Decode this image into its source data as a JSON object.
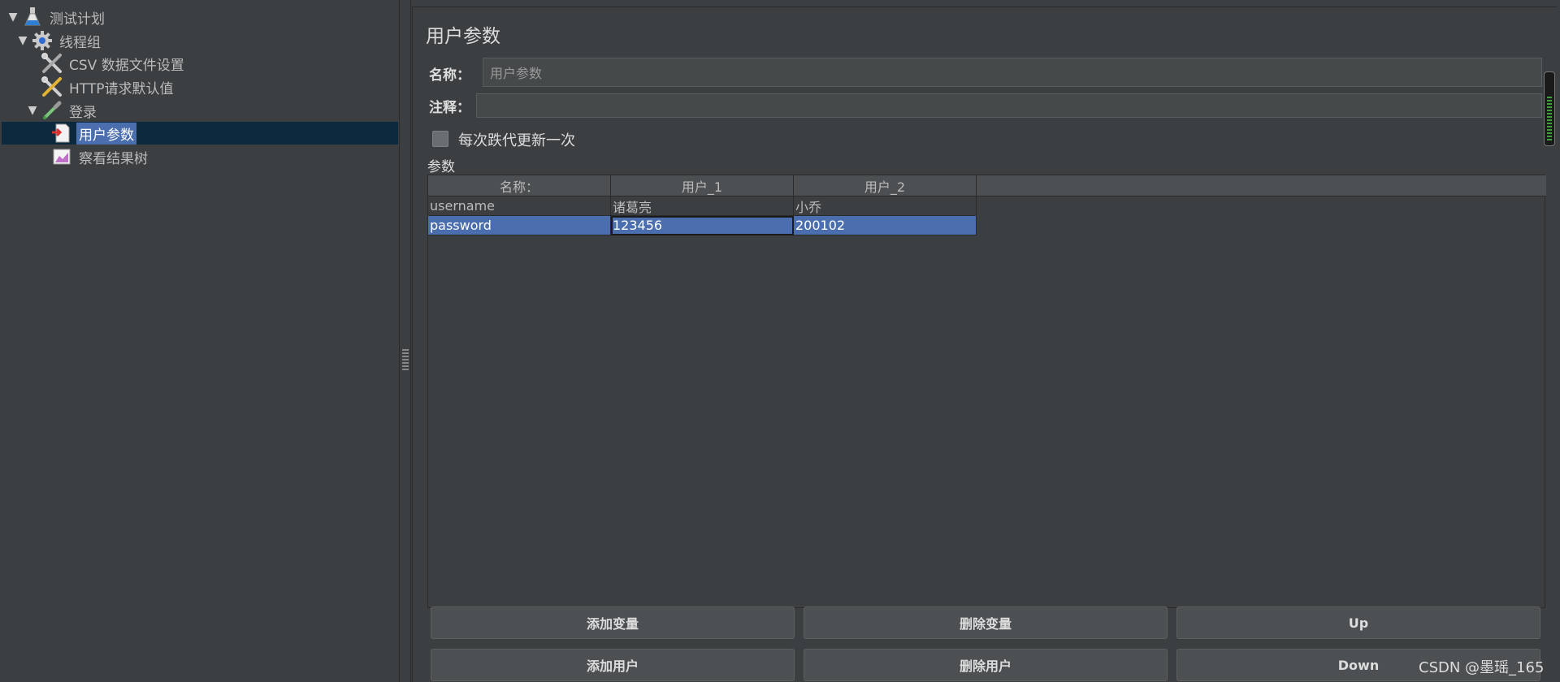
{
  "tree": {
    "items": [
      {
        "label": "测试计划",
        "icon": "flask-icon"
      },
      {
        "label": "线程组",
        "icon": "gear-icon"
      },
      {
        "label": "CSV 数据文件设置",
        "icon": "wrench-scissors-icon"
      },
      {
        "label": "HTTP请求默认值",
        "icon": "wrench-scissors-icon"
      },
      {
        "label": "登录",
        "icon": "pipette-icon"
      },
      {
        "label": "用户参数",
        "icon": "document-arrow-icon"
      },
      {
        "label": "察看结果树",
        "icon": "chart-icon"
      }
    ]
  },
  "main": {
    "title": "用户参数",
    "name_label": "名称：",
    "name_value": "用户参数",
    "comment_label": "注释：",
    "comment_value": "",
    "iteration_checkbox_label": "每次跌代更新一次",
    "params_label": "参数",
    "table": {
      "headers": [
        "名称：",
        "用户_1",
        "用户_2"
      ],
      "rows": [
        [
          "username",
          "诸葛亮",
          "小乔"
        ],
        [
          "password",
          "123456",
          "200102"
        ]
      ]
    },
    "buttons": {
      "add_variable": "添加变量",
      "delete_variable": "删除变量",
      "up": "Up",
      "add_user": "添加用户",
      "delete_user": "删除用户",
      "down": "Down"
    }
  },
  "watermark": "CSDN @墨瑶_165",
  "colors": {
    "background": "#3c3f41",
    "selection": "#4b6eaf",
    "tree_selection_row": "#0d293e"
  }
}
